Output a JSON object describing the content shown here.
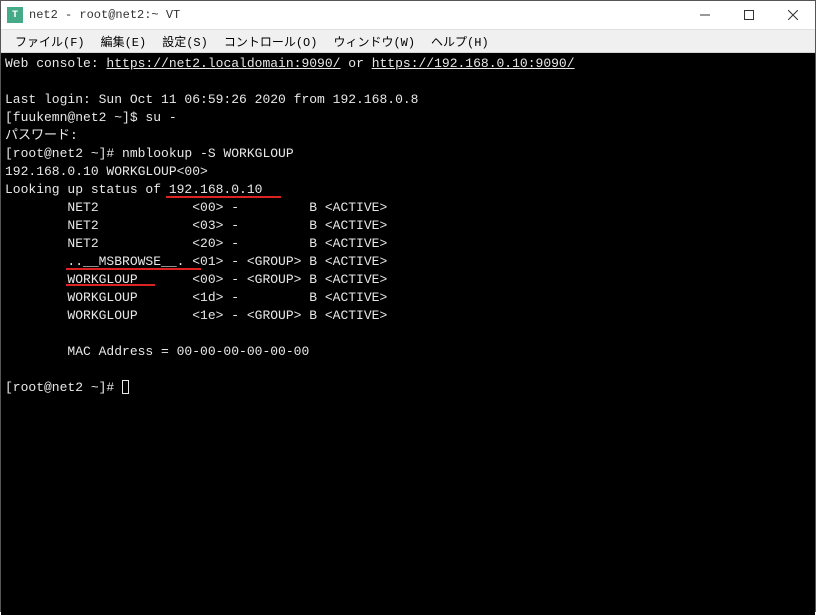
{
  "window": {
    "icon_letter": "T",
    "title": "net2 - root@net2:~ VT"
  },
  "menu": {
    "file": "ファイル(F)",
    "edit": "編集(E)",
    "settings": "設定(S)",
    "control": "コントロール(O)",
    "window": "ウィンドウ(W)",
    "help": "ヘルプ(H)"
  },
  "terminal": {
    "webconsole_prefix": "Web console: ",
    "webconsole_url1": "https://net2.localdomain:9090/",
    "webconsole_or": " or ",
    "webconsole_url2": "https://192.168.0.10:9090/",
    "lastlogin": "Last login: Sun Oct 11 06:59:26 2020 from 192.168.0.8",
    "prompt1": "[fuukemn@net2 ~]$ su -",
    "password_label": "パスワード:",
    "prompt2": "[root@net2 ~]# nmblookup -S WORKGLOUP",
    "line_ip": "192.168.0.10 WORKGLOUP<00>",
    "line_status": "Looking up status of 192.168.0.10",
    "row1": "        NET2            <00> -         B <ACTIVE>",
    "row2": "        NET2            <03> -         B <ACTIVE>",
    "row3": "        NET2            <20> -         B <ACTIVE>",
    "row4": "        ..__MSBROWSE__. <01> - <GROUP> B <ACTIVE>",
    "row5": "        WORKGLOUP       <00> - <GROUP> B <ACTIVE>",
    "row6": "        WORKGLOUP       <1d> -         B <ACTIVE>",
    "row7": "        WORKGLOUP       <1e> - <GROUP> B <ACTIVE>",
    "mac": "        MAC Address = 00-00-00-00-00-00",
    "prompt3": "[root@net2 ~]# "
  }
}
